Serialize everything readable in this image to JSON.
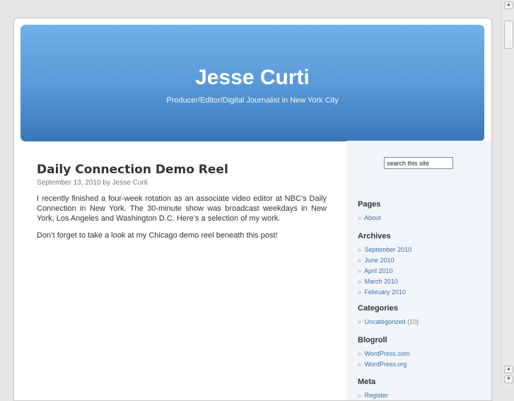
{
  "header": {
    "title": "Jesse Curti",
    "description": "Producer/Editor/Digital Journalist in New York City"
  },
  "post": {
    "title": "Daily Connection Demo Reel",
    "meta": "September 13, 2010 by Jesse Curti",
    "paragraphs": [
      "I recently finished a four-week rotation as an associate video editor at NBC’s Daily Connection in New York.  The 30-minute show was broadcast weekdays in New York, Los Angeles and Washington D.C.  Here’s a selection of my work.",
      "Don’t forget to take a look at my Chicago demo reel beneath this post!"
    ]
  },
  "sidebar": {
    "search_value": "search this site",
    "bullet": "»",
    "pages": {
      "heading": "Pages",
      "items": [
        "About"
      ]
    },
    "archives": {
      "heading": "Archives",
      "items": [
        "September 2010",
        "June 2010",
        "April 2010",
        "March 2010",
        "February 2010"
      ]
    },
    "categories": {
      "heading": "Categories",
      "items": [
        {
          "label": "Uncategorized",
          "count": "(10)"
        }
      ]
    },
    "blogroll": {
      "heading": "Blogroll",
      "items": [
        "WordPress.com",
        "WordPress.org"
      ]
    },
    "meta": {
      "heading": "Meta",
      "items": [
        "Register"
      ]
    }
  },
  "scrollbar": {
    "up_glyph": "▲",
    "down_glyph": "▼"
  }
}
